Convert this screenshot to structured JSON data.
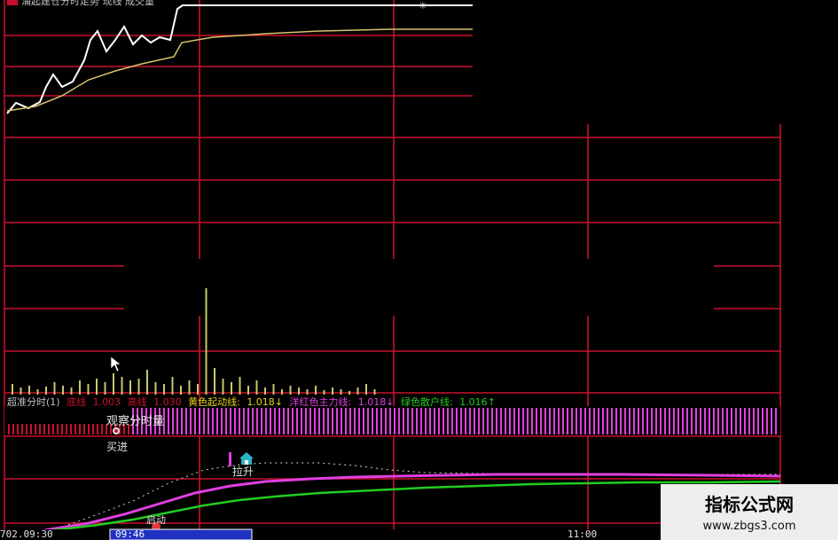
{
  "top_header": {
    "text": "涌起建仓分时走势  现线  成交量"
  },
  "legend": {
    "indicator": "超准分时(1)",
    "red_label": "底线",
    "red_value": "1.003",
    "red2_label": "高线",
    "red2_value": "1.030",
    "yellow_label": "黄色起动线:",
    "yellow_value": "1.018↓",
    "magenta_label": "洋红色主力线:",
    "magenta_value": "1.018↓",
    "green_label": "绿色散户线:",
    "green_value": "1.016↑"
  },
  "labels": {
    "observe": "观察分时量",
    "buy": "买进",
    "lift": "拉升",
    "start": "启动"
  },
  "time_axis": {
    "left_stamp": "702.09:30",
    "cursor_time": "09:46",
    "mid_time": "11:00"
  },
  "watermark": {
    "title": "指标公式网",
    "url": "www.zbgs3.com"
  },
  "colors": {
    "grid": "#c8102e",
    "price_line": "#ffffff",
    "avg_line": "#d9c36a",
    "volume_bar": "#c8c86e",
    "magenta": "#e040e0",
    "green": "#22cc22",
    "dotted": "#cfcfcf"
  },
  "icons": [
    "cursor-arrow-icon",
    "house-icon",
    "start-dot-icon",
    "observe-dot-icon"
  ]
}
